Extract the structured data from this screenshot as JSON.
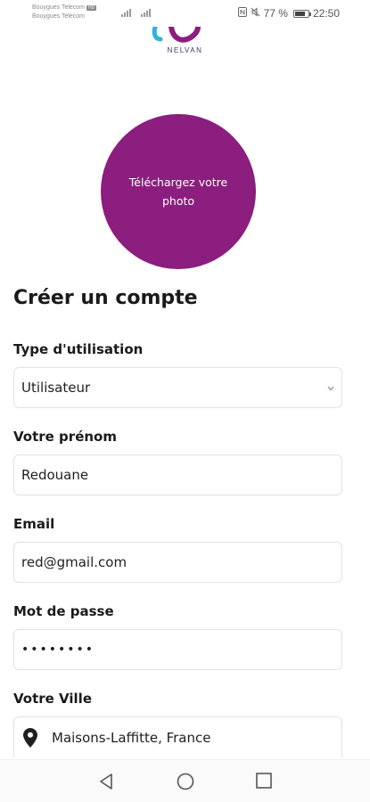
{
  "status_bar": {
    "carrier_1": "Bouygues Telecom",
    "carrier_1_badge": "HD",
    "carrier_2": "Bouygues Telecom",
    "battery_percent": "77 %",
    "battery_level": 0.77,
    "time": "22:50",
    "icons": [
      "nfc-icon",
      "mute-icon",
      "battery-icon"
    ]
  },
  "brand": {
    "name": "NELVAN",
    "accent": "#8b1e7e",
    "secondary": "#2bb5d6"
  },
  "photo_upload": {
    "label": "Téléchargez votre photo"
  },
  "form": {
    "title": "Créer un compte",
    "usage_type": {
      "label": "Type d'utilisation",
      "value": "Utilisateur"
    },
    "first_name": {
      "label": "Votre prénom",
      "value": "Redouane"
    },
    "email": {
      "label": "Email",
      "value": "red@gmail.com"
    },
    "password": {
      "label": "Mot de passe",
      "value": "••••••••"
    },
    "city": {
      "label": "Votre Ville",
      "value": "Maisons-Laffitte, France"
    }
  },
  "nav": {
    "buttons": [
      "back-icon",
      "home-icon",
      "recents-icon"
    ]
  }
}
